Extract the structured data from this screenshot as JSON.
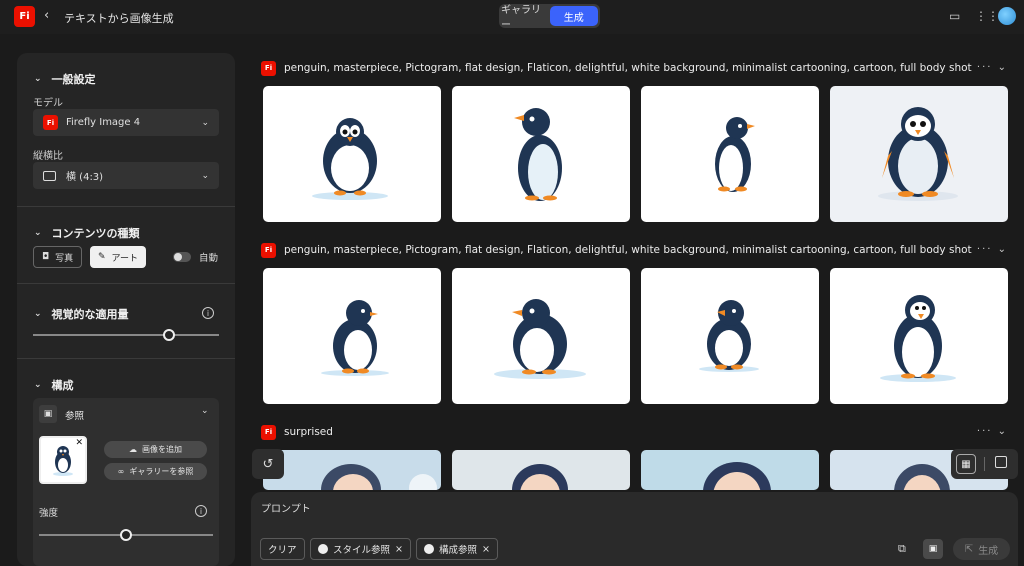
{
  "header": {
    "logo_text": "Fi",
    "title": "テキストから画像生成",
    "tabs": [
      "ギャラリー",
      "生成"
    ],
    "active_tab": 1
  },
  "sidebar": {
    "general": {
      "title": "一般設定",
      "model_label": "モデル",
      "model_value": "Firefly Image 4",
      "aspect_label": "縦横比",
      "aspect_value": "横 (4:3)"
    },
    "content_type": {
      "title": "コンテンツの種類",
      "photo": "写真",
      "art": "アート",
      "auto": "自動"
    },
    "visual_intensity": {
      "title": "視覚的な適用量",
      "value_fraction": 0.73
    },
    "composition": {
      "title": "構成",
      "reference_label": "参照",
      "add_image": "画像を追加",
      "browse_gallery": "ギャラリーを参照",
      "strength_label": "強度",
      "strength_fraction": 0.5
    }
  },
  "results": [
    {
      "prompt": "penguin, masterpiece, Pictogram, flat design, Flaticon, delightful, white background, minimalist cartooning, cartoon, full body shot"
    },
    {
      "prompt": "penguin, masterpiece, Pictogram, flat design, Flaticon, delightful, white background, minimalist cartooning, cartoon, full body shot"
    },
    {
      "prompt": "surprised"
    }
  ],
  "prompt_bar": {
    "label": "プロンプト",
    "clear": "クリア",
    "style_ref": "スタイル参照",
    "composition_ref": "構成参照",
    "generate": "生成"
  },
  "colors": {
    "accent": "#3b63fb",
    "brand": "#eb1000"
  }
}
